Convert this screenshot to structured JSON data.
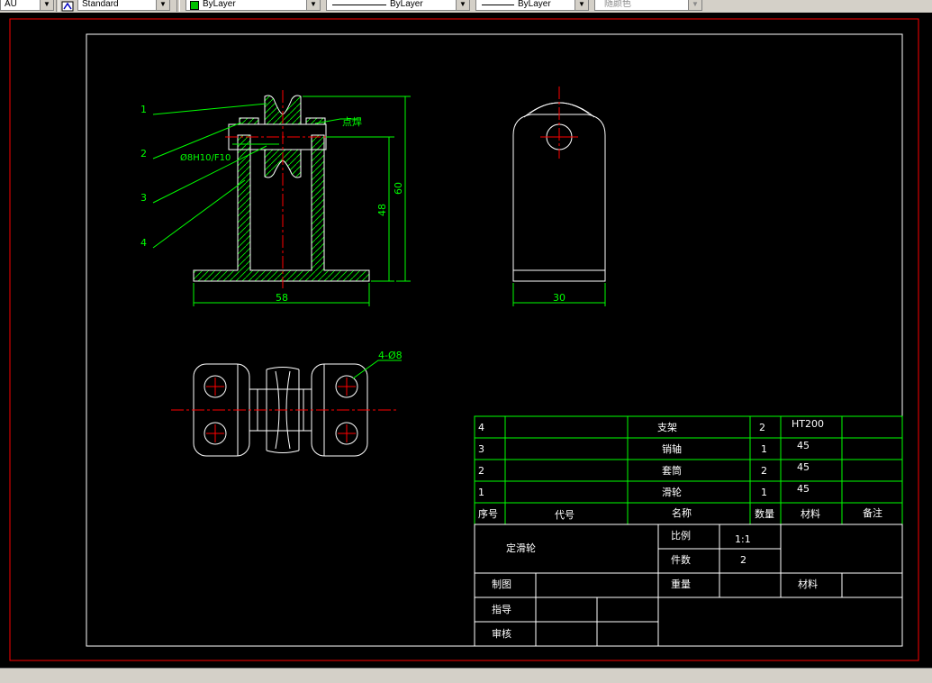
{
  "toolbar": {
    "textstyle_value": "Standard",
    "layer_value": "ByLayer",
    "linetype_value": "ByLayer",
    "lineweight_value": "ByLayer",
    "plotstyle_value": "随颜色",
    "cut_left_value": "AU"
  },
  "colors": {
    "drawing_bg": "#000000",
    "border_red": "#ff0000",
    "geometry_white": "#ffffff",
    "annotation_green": "#00ff00",
    "centerline_red": "#ff0000",
    "toolbar_gray": "#d4d0c8"
  },
  "front_view": {
    "leaders": [
      "1",
      "2",
      "3",
      "4"
    ],
    "weld_note": "点焊",
    "fit_note": "Ø8H10/F10",
    "dim_width": "58",
    "dim_height_48": "48",
    "dim_height_60": "60"
  },
  "side_view": {
    "dim_width": "30"
  },
  "top_view": {
    "hole_note": "4-Ø8"
  },
  "bom": {
    "rows": [
      {
        "seq": "4",
        "code": "",
        "name": "支架",
        "qty": "2",
        "material": "HT200",
        "note": ""
      },
      {
        "seq": "3",
        "code": "",
        "name": "销轴",
        "qty": "1",
        "material": "45",
        "note": ""
      },
      {
        "seq": "2",
        "code": "",
        "name": "套筒",
        "qty": "2",
        "material": "45",
        "note": ""
      },
      {
        "seq": "1",
        "code": "",
        "name": "滑轮",
        "qty": "1",
        "material": "45",
        "note": ""
      }
    ],
    "headers": {
      "seq": "序号",
      "code": "代号",
      "name": "名称",
      "qty": "数量",
      "material": "材料",
      "note": "备注"
    }
  },
  "title_block": {
    "drawing_name": "定滑轮",
    "scale_label": "比例",
    "scale_value": "1:1",
    "pieces_label": "件数",
    "pieces_value": "2",
    "drawn_label": "制图",
    "weight_label": "重量",
    "material_label": "材料",
    "guide_label": "指导",
    "review_label": "审核"
  }
}
